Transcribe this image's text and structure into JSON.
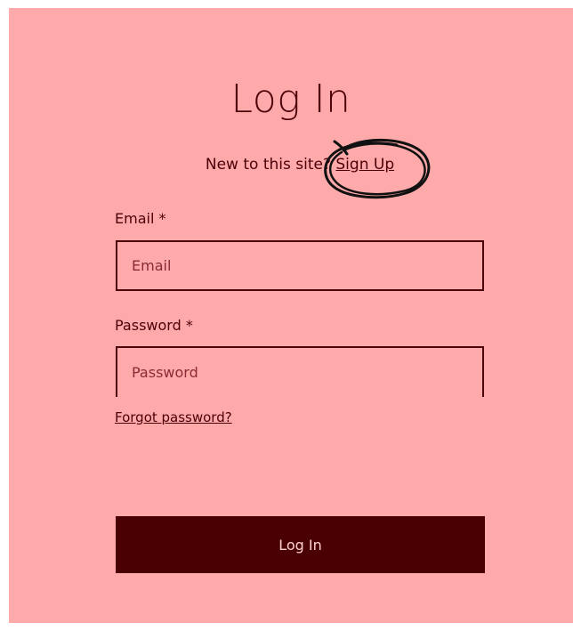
{
  "form": {
    "title": "Log In",
    "signup_prompt": "New to this site?",
    "signup_link": "Sign Up",
    "email_label": "Email *",
    "email_placeholder": "Email",
    "password_label": "Password *",
    "password_placeholder": "Password",
    "forgot_link": "Forgot password?",
    "login_button": "Log In"
  },
  "colors": {
    "background": "#ffaaaa",
    "text": "#4c0008",
    "button": "#4a0003",
    "button_text": "#ffd0d0",
    "annotation": "#111111"
  },
  "annotation": {
    "icon": "scribble-circle-annotation"
  }
}
